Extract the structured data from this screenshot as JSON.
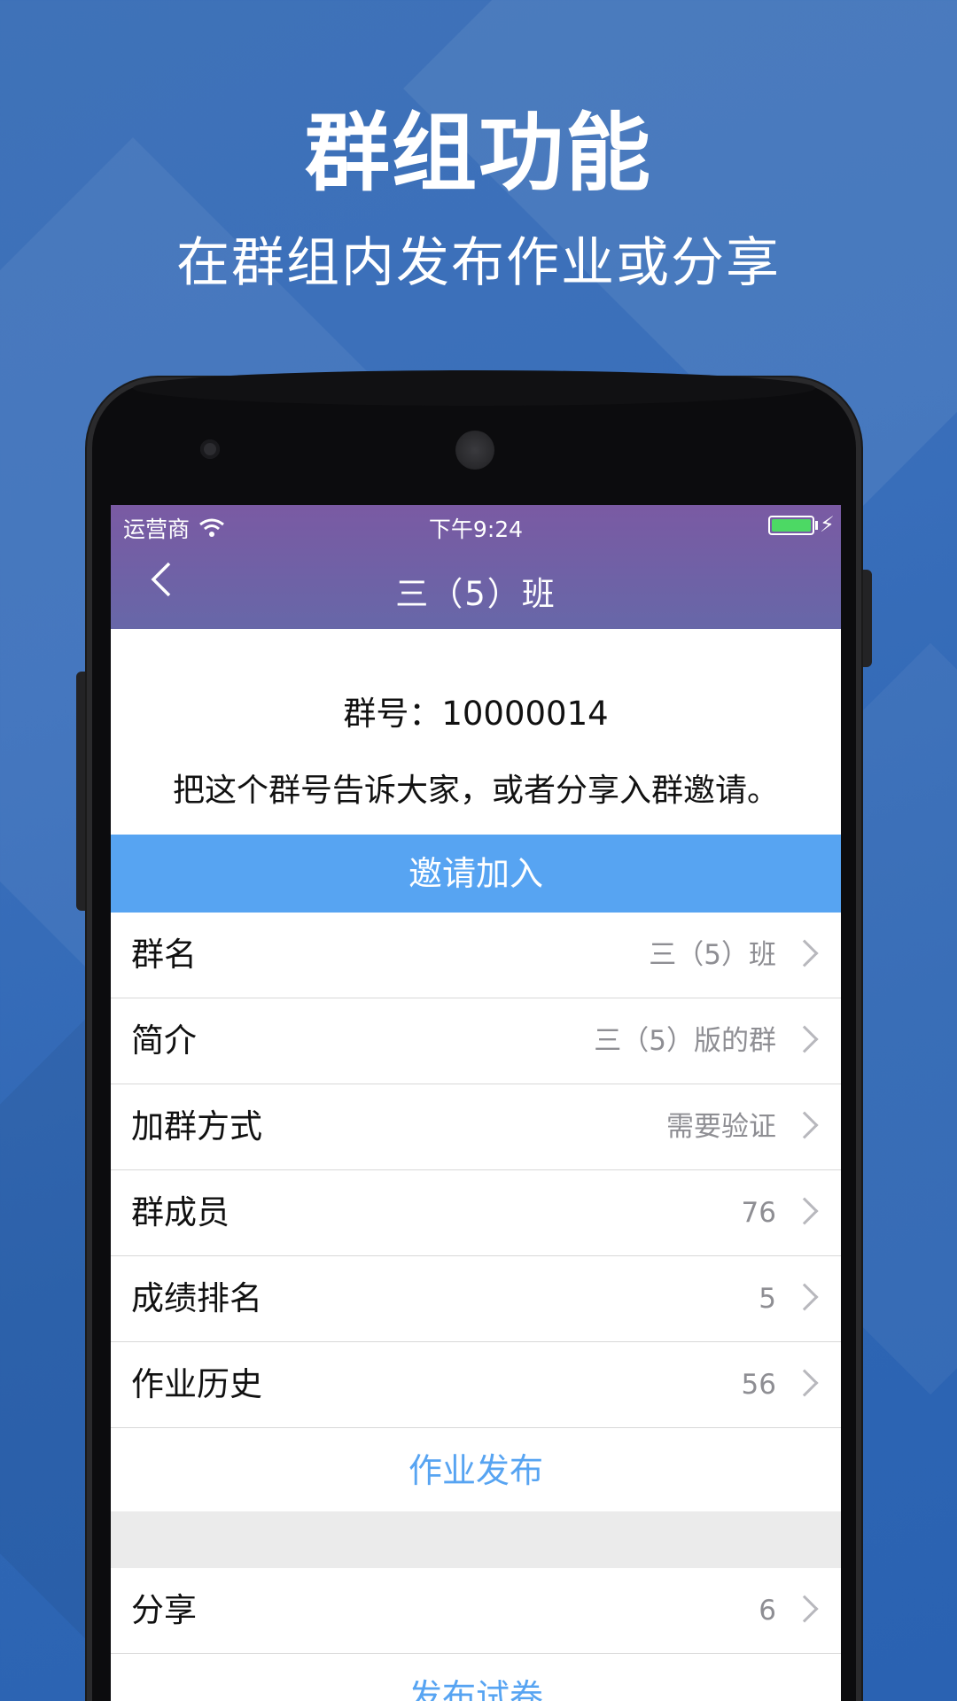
{
  "promo": {
    "title": "群组功能",
    "subtitle": "在群组内发布作业或分享"
  },
  "status_bar": {
    "carrier": "运营商",
    "time": "下午9:24",
    "wifi_icon": "wifi-icon",
    "battery_icon": "battery-icon",
    "charging_icon": "charging-bolt-icon"
  },
  "nav": {
    "back_icon": "chevron-left-icon",
    "title": "三（5）班"
  },
  "group_info": {
    "number_line": "群号：10000014",
    "hint": "把这个群号告诉大家，或者分享入群邀请。"
  },
  "invite_button": "邀请加入",
  "rows": [
    {
      "label": "群名",
      "value": "三（5）班"
    },
    {
      "label": "简介",
      "value": "三（5）版的群"
    },
    {
      "label": "加群方式",
      "value": "需要验证"
    },
    {
      "label": "群成员",
      "value": "76"
    },
    {
      "label": "成绩排名",
      "value": "5"
    },
    {
      "label": "作业历史",
      "value": "56"
    }
  ],
  "publish_homework": "作业发布",
  "share_row": {
    "label": "分享",
    "value": "6"
  },
  "publish_exam": "发布试卷",
  "colors": {
    "accent_blue": "#57a4f2",
    "nav_purple": "#7a5aa3",
    "background_blue": "#3a6fbb"
  }
}
